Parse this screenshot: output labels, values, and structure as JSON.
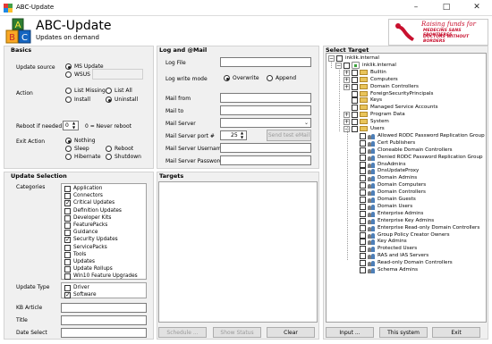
{
  "window": {
    "title": "ABC-Update"
  },
  "header": {
    "title": "ABC-Update",
    "subtitle": "Updates on demand"
  },
  "sponsor": {
    "raising": "Raising funds for",
    "line1": "MEDECINS SANS FRONTIERES",
    "line2": "DOCTORS WITHOUT BORDERS"
  },
  "basics": {
    "title": "Basics",
    "update_source": {
      "label": "Update source",
      "options": [
        "MS Update",
        "WSUS"
      ],
      "selected": "MS Update"
    },
    "action": {
      "label": "Action",
      "options": [
        "List Missing",
        "List All",
        "Install",
        "Uninstall"
      ],
      "selected": "Uninstall"
    },
    "reboot": {
      "label": "Reboot if needed",
      "value": "0",
      "hint": "0 = Never reboot"
    },
    "exit_action": {
      "label": "Exit Action",
      "options": [
        "Nothing",
        "Sleep",
        "Reboot",
        "Hibernate",
        "Shutdown"
      ],
      "selected": "Nothing"
    }
  },
  "update_selection": {
    "title": "Update Selection",
    "categories_label": "Categories",
    "categories": [
      {
        "label": "Application",
        "checked": false
      },
      {
        "label": "Connectors",
        "checked": false
      },
      {
        "label": "Critical Updates",
        "checked": true
      },
      {
        "label": "Definition Updates",
        "checked": false
      },
      {
        "label": "Developer Kits",
        "checked": false
      },
      {
        "label": "FeaturePacks",
        "checked": false
      },
      {
        "label": "Guidance",
        "checked": false
      },
      {
        "label": "Security Updates",
        "checked": true
      },
      {
        "label": "ServicePacks",
        "checked": false
      },
      {
        "label": "Tools",
        "checked": false
      },
      {
        "label": "Updates",
        "checked": false
      },
      {
        "label": "Update Rollups",
        "checked": false
      },
      {
        "label": "Win10 Feature Upgrades",
        "checked": false
      }
    ],
    "update_type_label": "Update Type",
    "update_types": [
      {
        "label": "Driver",
        "checked": false
      },
      {
        "label": "Software",
        "checked": true
      }
    ],
    "kb_label": "KB Article",
    "title_label": "Title",
    "date_label": "Date Select"
  },
  "log_mail": {
    "title": "Log and @Mail",
    "log_file_label": "Log File",
    "log_write_mode_label": "Log write mode",
    "write_modes": [
      "Overwrite",
      "Append"
    ],
    "write_mode_selected": "Overwrite",
    "mail_from_label": "Mail from",
    "mail_to_label": "Mail to",
    "mail_server_label": "Mail Server",
    "mail_port_label": "Mail Server port #",
    "mail_port_value": "25",
    "send_test_label": "Send test eMail",
    "mail_user_label": "Mail Server Username",
    "mail_pass_label": "Mail Server Password"
  },
  "targets": {
    "title": "Targets",
    "schedule_label": "Schedule ...",
    "show_status_label": "Show Status",
    "clear_label": "Clear"
  },
  "select_target": {
    "title": "Select Target",
    "root": "inklik.internal",
    "domain": "inklik.internal",
    "folders": [
      "Builtin",
      "Computers",
      "Domain Controllers",
      "ForeignSecurityPrincipals",
      "Keys",
      "Managed Service Accounts",
      "Program Data",
      "System",
      "Users"
    ],
    "users": [
      "Allowed RODC Password Replication Group",
      "Cert Publishers",
      "Cloneable Domain Controllers",
      "Denied RODC Password Replication Group",
      "DnsAdmins",
      "DnsUpdateProxy",
      "Domain Admins",
      "Domain Computers",
      "Domain Controllers",
      "Domain Guests",
      "Domain Users",
      "Enterprise Admins",
      "Enterprise Key Admins",
      "Enterprise Read-only Domain Controllers",
      "Group Policy Creator Owners",
      "Key Admins",
      "Protected Users",
      "RAS and IAS Servers",
      "Read-only Domain Controllers",
      "Schema Admins"
    ],
    "input_label": "Input ...",
    "this_system_label": "This system",
    "exit_label": "Exit"
  },
  "colors": {
    "msf_red": "#c8102e",
    "panel": "#f0f0f0",
    "folder": "#e9c45a"
  }
}
